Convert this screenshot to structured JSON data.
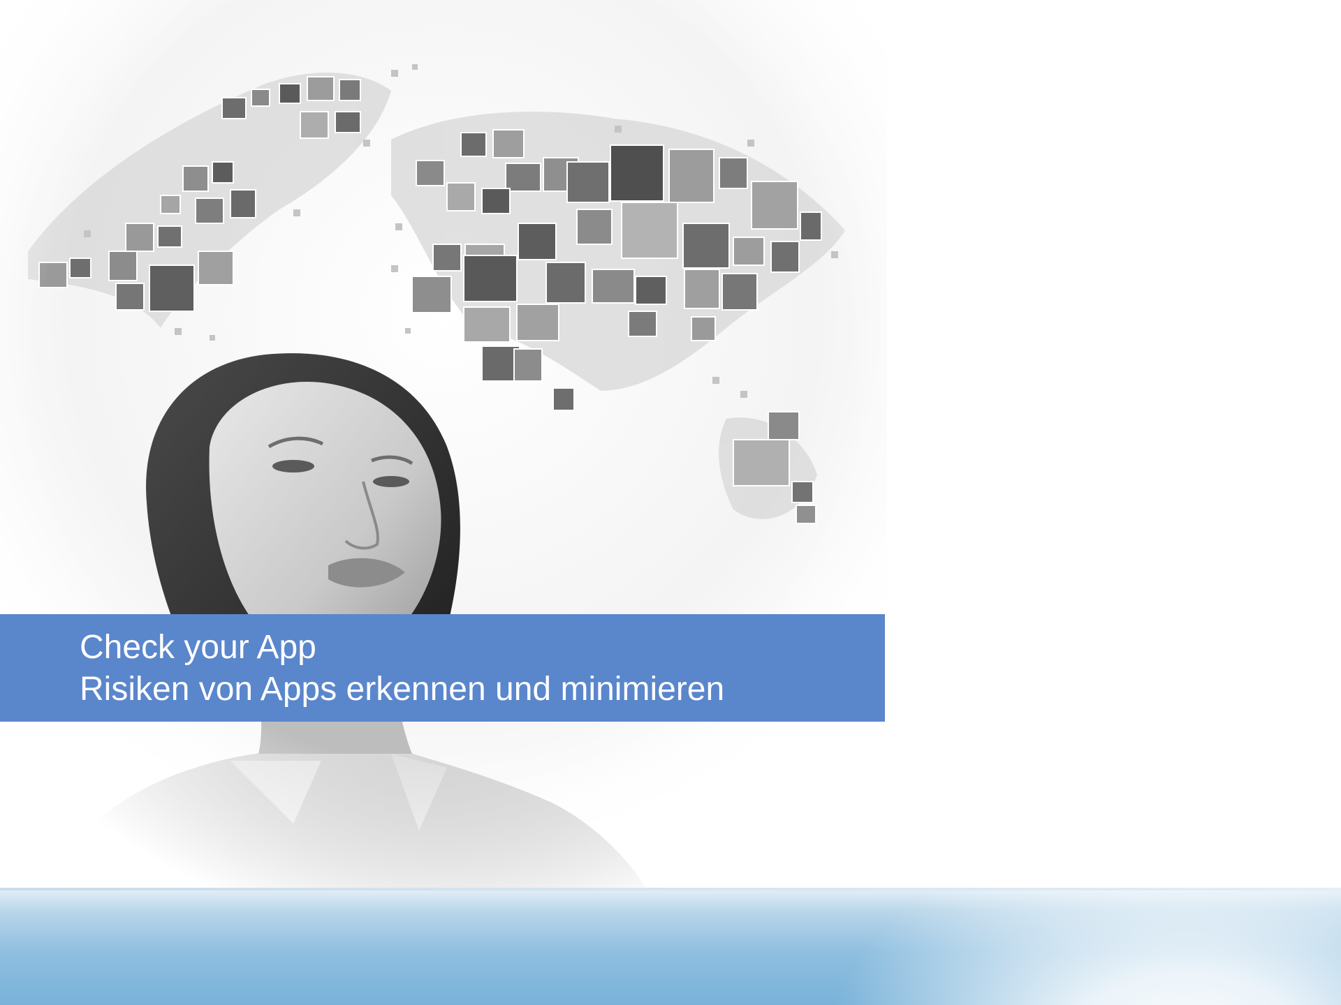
{
  "slide": {
    "title": "Check your App",
    "subtitle": "Risiken von Apps erkennen und minimieren"
  },
  "hero_image": {
    "icon": "woman-looking-up-world-map-photos-image"
  },
  "colors": {
    "title_bar": "#5a86cc",
    "title_text": "#ffffff",
    "band_blue": "#79b2d9",
    "background": "#ffffff"
  }
}
